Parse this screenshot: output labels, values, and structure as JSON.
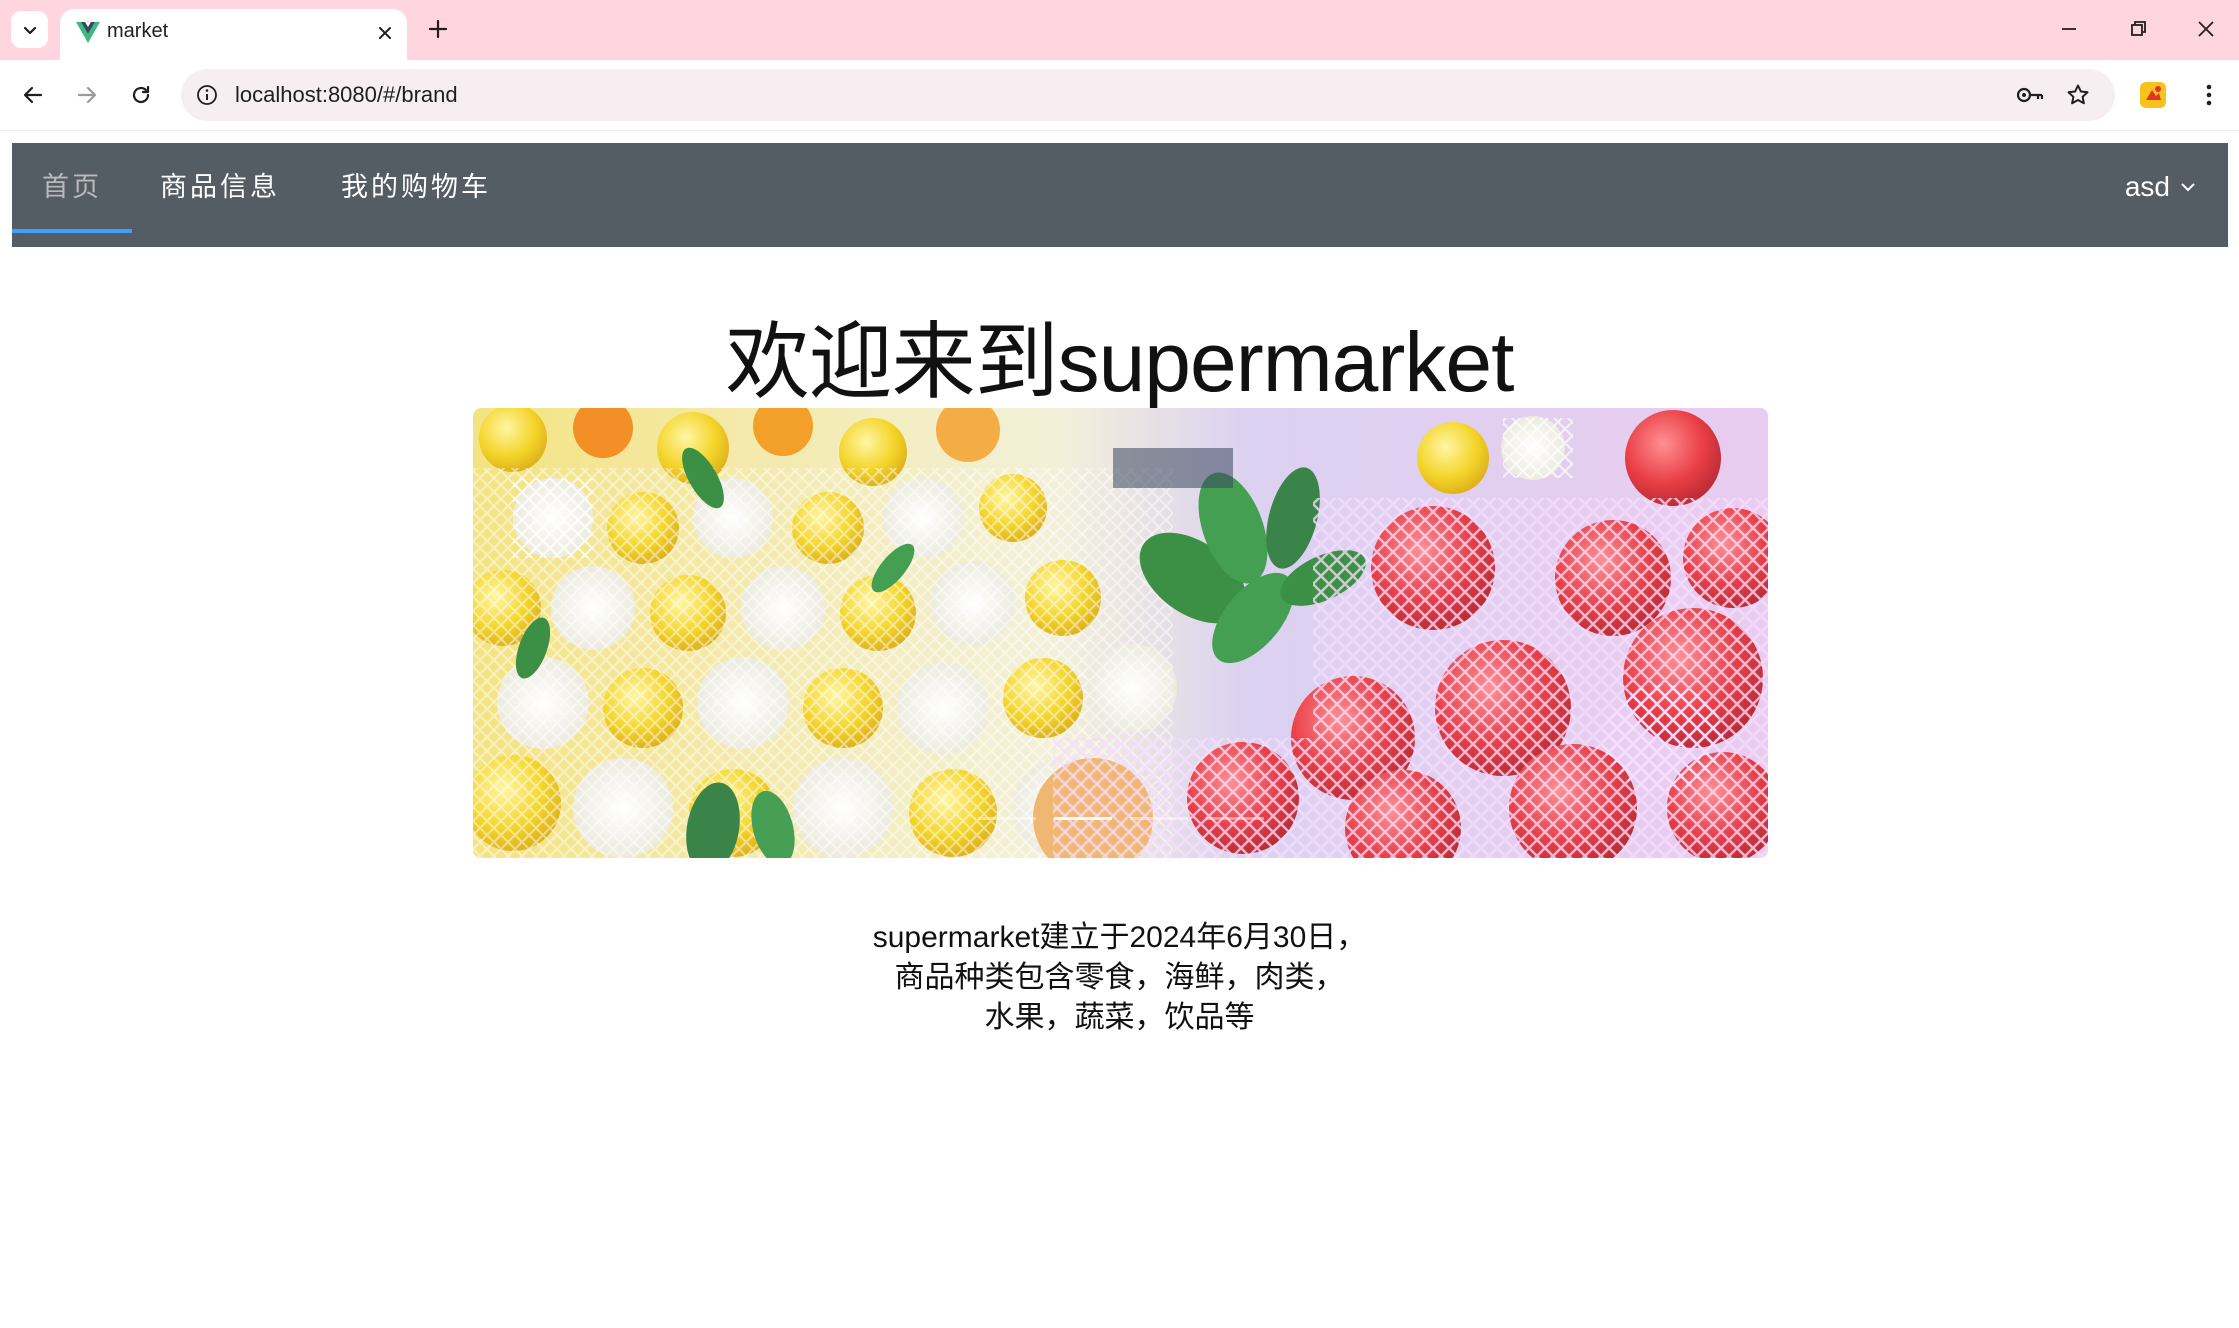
{
  "browser": {
    "tab_title": "market",
    "url": "localhost:8080/#/brand"
  },
  "nav": {
    "items": [
      {
        "label": "首页",
        "active": true
      },
      {
        "label": "商品信息",
        "active": false
      },
      {
        "label": "我的购物车",
        "active": false
      }
    ],
    "user": "asd",
    "background_color": "#545c64",
    "active_underline_color": "#409eff"
  },
  "page": {
    "title": "欢迎来到supermarket",
    "intro_lines": [
      "supermarket建立于2024年6月30日，",
      "商品种类包含零食，海鲜，肉类，",
      "水果，蔬菜，饮品等"
    ]
  },
  "carousel": {
    "image": "fruit-display",
    "active_index": 1,
    "slides": 4
  }
}
